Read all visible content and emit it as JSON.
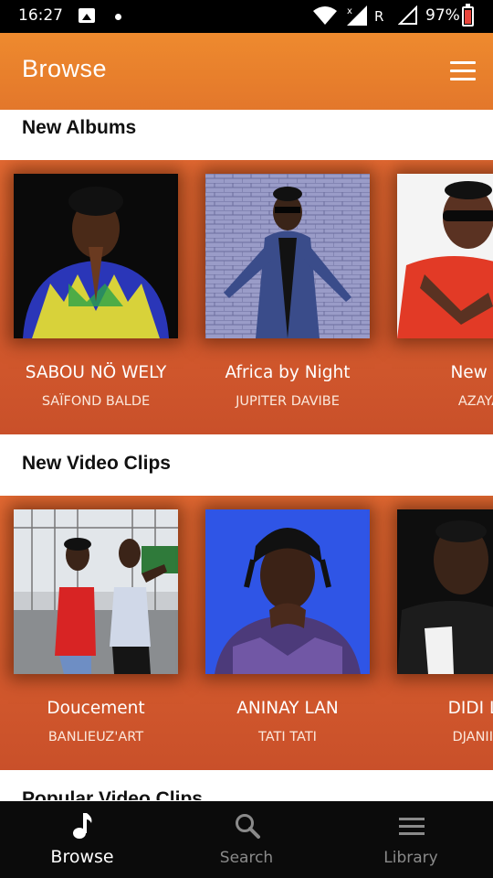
{
  "status_bar": {
    "time": "16:27",
    "network_label": "R",
    "battery": "97%",
    "icons": [
      "gallery-icon",
      "notification-dot-icon",
      "wifi-icon",
      "signal-icon",
      "signal-outline-icon",
      "battery-charging-icon"
    ]
  },
  "app_bar": {
    "title": "Browse",
    "menu_icon": "hamburger-menu-icon"
  },
  "colors": {
    "app_bar": "#e8812d",
    "band": "#d95d2e",
    "bottom_nav": "#0b0b0b"
  },
  "sections": [
    {
      "title": "New Albums",
      "items": [
        {
          "name": "SABOU NÖ WELY",
          "artist": "SAÏFOND BALDE"
        },
        {
          "name": "Africa by Night",
          "artist": "JUPITER DAVIBE"
        },
        {
          "name": "New Si",
          "artist": "AZAYA"
        }
      ]
    },
    {
      "title": "New Video Clips",
      "items": [
        {
          "name": "Doucement",
          "artist": "BANLIEUZ'ART"
        },
        {
          "name": "ANINAY LAN",
          "artist": "TATI TATI"
        },
        {
          "name": "DIDI LA",
          "artist": "DJANII A"
        }
      ]
    },
    {
      "title": "Popular Video Clips"
    }
  ],
  "bottom_nav": [
    {
      "label": "Browse",
      "icon": "music-note-icon",
      "active": true
    },
    {
      "label": "Search",
      "icon": "search-icon",
      "active": false
    },
    {
      "label": "Library",
      "icon": "library-icon",
      "active": false
    }
  ]
}
